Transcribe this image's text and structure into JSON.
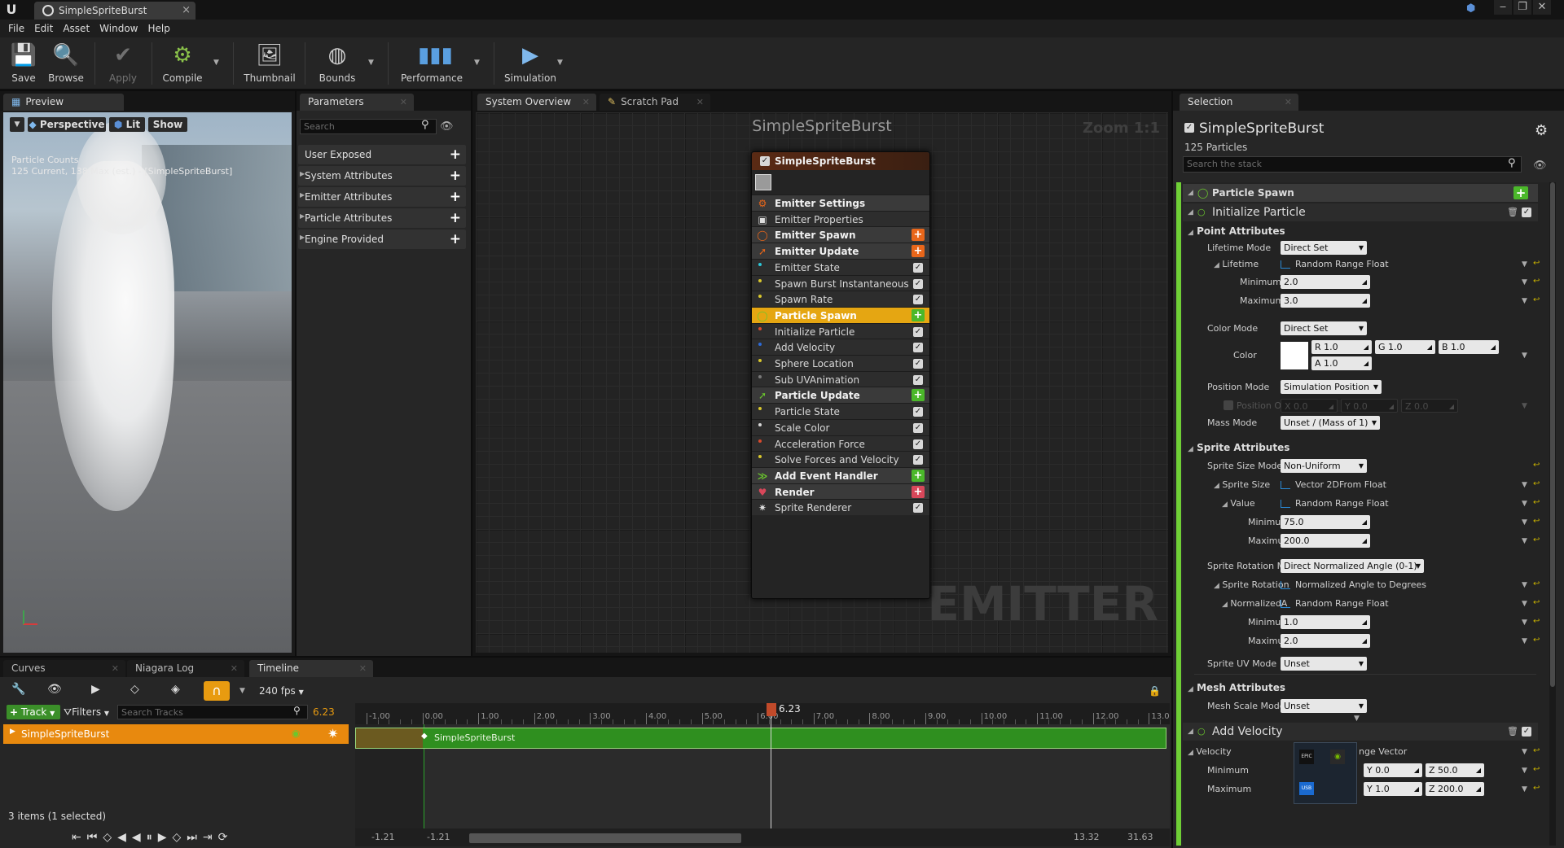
{
  "window": {
    "tab_title": "SimpleSpriteBurst"
  },
  "menu": [
    "File",
    "Edit",
    "Asset",
    "Window",
    "Help"
  ],
  "toolbar": {
    "save": "Save",
    "browse": "Browse",
    "apply": "Apply",
    "compile": "Compile",
    "thumbnail": "Thumbnail",
    "bounds": "Bounds",
    "performance": "Performance",
    "simulation": "Simulation"
  },
  "preview": {
    "tab": "Preview",
    "perspective": "Perspective",
    "lit": "Lit",
    "show": "Show",
    "counts_title": "Particle Counts",
    "counts_text": "125 Current, 138 Max (est.) - [SimpleSpriteBurst]"
  },
  "parameters": {
    "tab": "Parameters",
    "search_placeholder": "Search",
    "groups": [
      "User Exposed",
      "System Attributes",
      "Emitter Attributes",
      "Particle Attributes",
      "Engine Provided"
    ]
  },
  "overview": {
    "tabs": [
      "System Overview",
      "Scratch Pad"
    ],
    "graph_title": "SimpleSpriteBurst",
    "zoom": "Zoom 1:1",
    "watermark": "EMITTER",
    "node": {
      "title": "SimpleSpriteBurst",
      "rows": [
        {
          "label": "Emitter Settings",
          "kind": "head",
          "icon": "emitter-settings-icon",
          "color": "#e8661a"
        },
        {
          "label": "Emitter Properties",
          "kind": "sub",
          "icon": "cpu-icon"
        },
        {
          "label": "Emitter Spawn",
          "kind": "head",
          "icon": "emitter-spawn-icon",
          "color": "#e8661a",
          "add": "#e8661a"
        },
        {
          "label": "Emitter Update",
          "kind": "head",
          "icon": "emitter-update-icon",
          "color": "#e8661a",
          "add": "#e8661a"
        },
        {
          "label": "Emitter State",
          "kind": "sub",
          "dot": "#2dc7d8",
          "check": true
        },
        {
          "label": "Spawn Burst Instantaneous",
          "kind": "sub",
          "dot": "#d8c72d",
          "check": true
        },
        {
          "label": "Spawn Rate",
          "kind": "sub",
          "dot": "#d8c72d",
          "check": true
        },
        {
          "label": "Particle Spawn",
          "kind": "selected",
          "icon": "particle-spawn-icon",
          "color": "#6bc72d",
          "add": "#4bb82a"
        },
        {
          "label": "Initialize Particle",
          "kind": "sub",
          "dot": "#d84a2d",
          "check": true
        },
        {
          "label": "Add Velocity",
          "kind": "sub",
          "dot": "#2d6bd8",
          "check": true
        },
        {
          "label": "Sphere Location",
          "kind": "sub",
          "dot": "#d8c72d",
          "check": true
        },
        {
          "label": "Sub UVAnimation",
          "kind": "sub",
          "dot": "#7a7a7a",
          "check": true
        },
        {
          "label": "Particle Update",
          "kind": "head",
          "icon": "particle-update-icon",
          "color": "#6bc72d",
          "add": "#4bb82a"
        },
        {
          "label": "Particle State",
          "kind": "sub",
          "dot": "#d8c72d",
          "check": true
        },
        {
          "label": "Scale Color",
          "kind": "sub",
          "dot": "#d8d8d8",
          "check": true
        },
        {
          "label": "Acceleration Force",
          "kind": "sub",
          "dot": "#d84a2d",
          "check": true
        },
        {
          "label": "Solve Forces and Velocity",
          "kind": "sub",
          "dot": "#d8c72d",
          "check": true
        },
        {
          "label": "Add Event Handler",
          "kind": "head",
          "icon": "event-handler-icon",
          "color": "#6bc72d",
          "add": "#4bb82a"
        },
        {
          "label": "Render",
          "kind": "head",
          "icon": "render-icon",
          "color": "#d8475a",
          "add": "#d8475a"
        },
        {
          "label": "Sprite Renderer",
          "kind": "sub",
          "icon": "sprite-renderer-icon",
          "check": true
        }
      ]
    }
  },
  "selection": {
    "tab": "Selection",
    "title": "SimpleSpriteBurst",
    "particles": "125 Particles",
    "search_placeholder": "Search the stack",
    "particle_spawn": "Particle Spawn",
    "initialize_particle": "Initialize Particle",
    "point_attributes": "Point Attributes",
    "lifetime_mode_label": "Lifetime Mode",
    "lifetime_mode": "Direct Set",
    "lifetime_label": "Lifetime",
    "lifetime_value": "Random Range Float",
    "minimum_label": "Minimum",
    "maximum_label": "Maximum",
    "lifetime_min": "2.0",
    "lifetime_max": "3.0",
    "color_mode_label": "Color Mode",
    "color_mode": "Direct Set",
    "color_label": "Color",
    "color_r": "R 1.0",
    "color_g": "G 1.0",
    "color_b": "B 1.0",
    "color_a": "A 1.0",
    "position_mode_label": "Position Mode",
    "position_mode": "Simulation Position",
    "position_offset_label": "Position Of",
    "pos_x": "X 0.0",
    "pos_y": "Y 0.0",
    "pos_z": "Z 0.0",
    "mass_mode_label": "Mass Mode",
    "mass_mode": "Unset / (Mass of 1)",
    "sprite_attributes": "Sprite Attributes",
    "sprite_size_mode_label": "Sprite Size Mode",
    "sprite_size_mode": "Non-Uniform",
    "sprite_size_label": "Sprite Size",
    "sprite_size_value": "Vector 2DFrom Float",
    "value_label": "Value",
    "value_value": "Random Range Float",
    "size_min": "75.0",
    "size_max": "200.0",
    "sprite_rotation_mode_label": "Sprite Rotation Mo",
    "sprite_rotation_mode": "Direct Normalized Angle (0-1)",
    "sprite_rotation_label": "Sprite Rotation",
    "sprite_rotation_value": "Normalized Angle to Degrees",
    "normalized_label": "NormalizedA",
    "normalized_value": "Random Range Float",
    "rot_min": "1.0",
    "rot_max": "2.0",
    "sprite_uv_mode_label": "Sprite UV Mode",
    "sprite_uv_mode": "Unset",
    "mesh_attributes": "Mesh Attributes",
    "mesh_scale_mode_label": "Mesh Scale Mode",
    "mesh_scale_mode": "Unset",
    "add_velocity": "Add Velocity",
    "velocity_label": "Velocity",
    "velocity_value": "nge Vector",
    "vel_min_y": "Y 0.0",
    "vel_min_z": "Z 50.0",
    "vel_max_y": "Y 1.0",
    "vel_max_z": "Z 200.0",
    "overlay_top": "EPIC",
    "overlay_bottom": "USB"
  },
  "bottom_tabs": [
    "Curves",
    "Niagara Log",
    "Timeline"
  ],
  "timeline": {
    "fps": "240 fps",
    "track_btn": "Track",
    "filters_btn": "Filters",
    "search_placeholder": "Search Tracks",
    "current_time": "6.23",
    "track_name": "SimpleSpriteBurst",
    "bar_label": "SimpleSpriteBurst",
    "items_status": "3 items (1 selected)",
    "ruler": [
      "-1.00",
      "0.00",
      "1.00",
      "2.00",
      "3.00",
      "4.00",
      "5.00",
      "6.00",
      "7.00",
      "8.00",
      "9.00",
      "10.00",
      "11.00",
      "12.00",
      "13.0"
    ],
    "range_start": "-1.21",
    "range_start2": "-1.21",
    "range_end": "13.32",
    "range_end2": "31.63"
  }
}
